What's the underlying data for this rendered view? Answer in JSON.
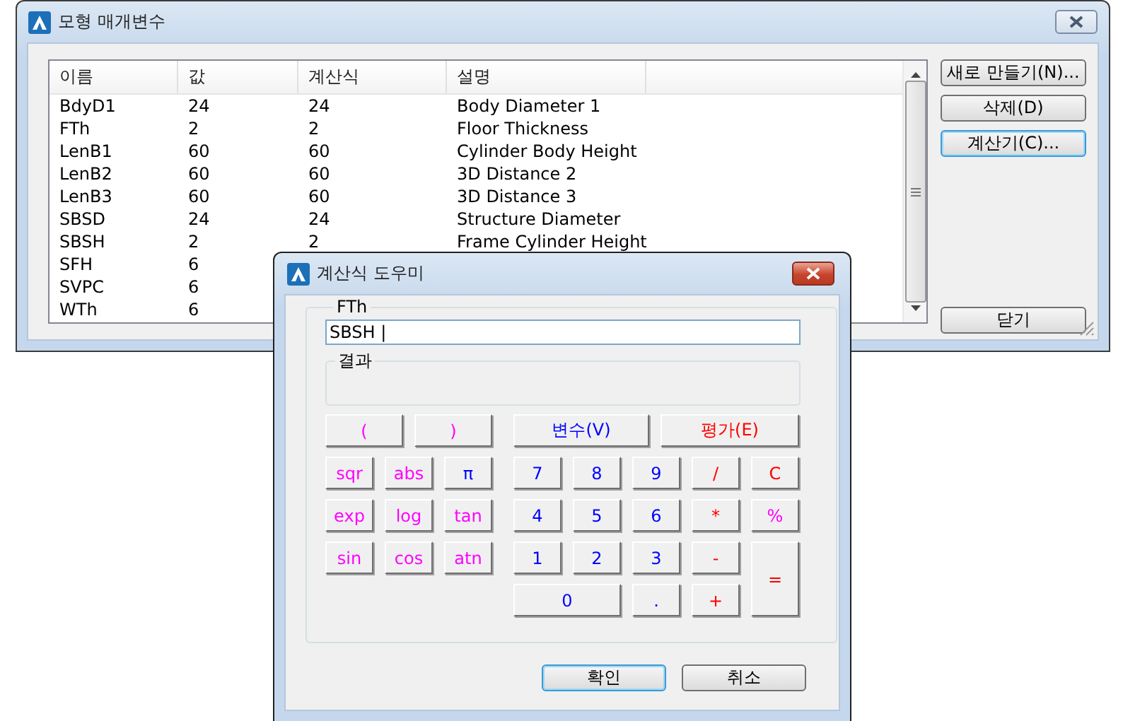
{
  "main_window": {
    "title": "모형 매개변수",
    "columns": [
      "이름",
      "값",
      "계산식",
      "설명"
    ],
    "rows": [
      {
        "name": "BdyD1",
        "value": "24",
        "expression": "24",
        "description": "Body Diameter 1"
      },
      {
        "name": "FTh",
        "value": "2",
        "expression": "2",
        "description": "Floor Thickness"
      },
      {
        "name": "LenB1",
        "value": "60",
        "expression": "60",
        "description": "Cylinder Body Height"
      },
      {
        "name": "LenB2",
        "value": "60",
        "expression": "60",
        "description": "3D Distance 2"
      },
      {
        "name": "LenB3",
        "value": "60",
        "expression": "60",
        "description": "3D Distance 3"
      },
      {
        "name": "SBSD",
        "value": "24",
        "expression": "24",
        "description": "Structure Diameter"
      },
      {
        "name": "SBSH",
        "value": "2",
        "expression": "2",
        "description": "Frame Cylinder Height"
      },
      {
        "name": "SFH",
        "value": "6"
      },
      {
        "name": "SVPC",
        "value": "6"
      },
      {
        "name": "WTh",
        "value": "6"
      }
    ],
    "buttons": [
      {
        "label": "새로 만들기(N)...",
        "focused": false
      },
      {
        "label": "삭제(D)",
        "focused": false
      },
      {
        "label": "계산기(C)...",
        "focused": true
      }
    ],
    "close_button": {
      "label": "닫기",
      "focused": false
    }
  },
  "calculator_dialog": {
    "title": "계산식 도우미",
    "group_label": "FTh",
    "expression_value": "SBSH |",
    "result_label": "결과",
    "keys": [
      {
        "label": "(",
        "color": "#ff00ff"
      },
      {
        "label": ")",
        "color": "#ff00ff"
      },
      {
        "label": "변수(V)",
        "color": "#0000ff"
      },
      {
        "label": "평가(E)",
        "color": "#ff0000"
      },
      {
        "label": "sqr",
        "color": "#ff00ff"
      },
      {
        "label": "abs",
        "color": "#ff00ff"
      },
      {
        "label": "π",
        "color": "#0000ff"
      },
      {
        "label": "7",
        "color": "#0000ff"
      },
      {
        "label": "8",
        "color": "#0000ff"
      },
      {
        "label": "9",
        "color": "#0000ff"
      },
      {
        "label": "/",
        "color": "#ff0000"
      },
      {
        "label": "C",
        "color": "#ff0000"
      },
      {
        "label": "exp",
        "color": "#ff00ff"
      },
      {
        "label": "log",
        "color": "#ff00ff"
      },
      {
        "label": "tan",
        "color": "#ff00ff"
      },
      {
        "label": "4",
        "color": "#0000ff"
      },
      {
        "label": "5",
        "color": "#0000ff"
      },
      {
        "label": "6",
        "color": "#0000ff"
      },
      {
        "label": "*",
        "color": "#ff0000"
      },
      {
        "label": "%",
        "color": "#ff00ff"
      },
      {
        "label": "sin",
        "color": "#ff00ff"
      },
      {
        "label": "cos",
        "color": "#ff00ff"
      },
      {
        "label": "atn",
        "color": "#ff00ff"
      },
      {
        "label": "1",
        "color": "#0000ff"
      },
      {
        "label": "2",
        "color": "#0000ff"
      },
      {
        "label": "3",
        "color": "#0000ff"
      },
      {
        "label": "-",
        "color": "#ff0000"
      },
      {
        "label": "=",
        "color": "#ff0000"
      },
      {
        "label": "0",
        "color": "#0000ff"
      },
      {
        "label": ".",
        "color": "#0000ff"
      },
      {
        "label": "+",
        "color": "#ff0000"
      }
    ],
    "buttons": [
      {
        "label": "확인",
        "focused": true
      },
      {
        "label": "취소",
        "focused": false
      }
    ]
  }
}
